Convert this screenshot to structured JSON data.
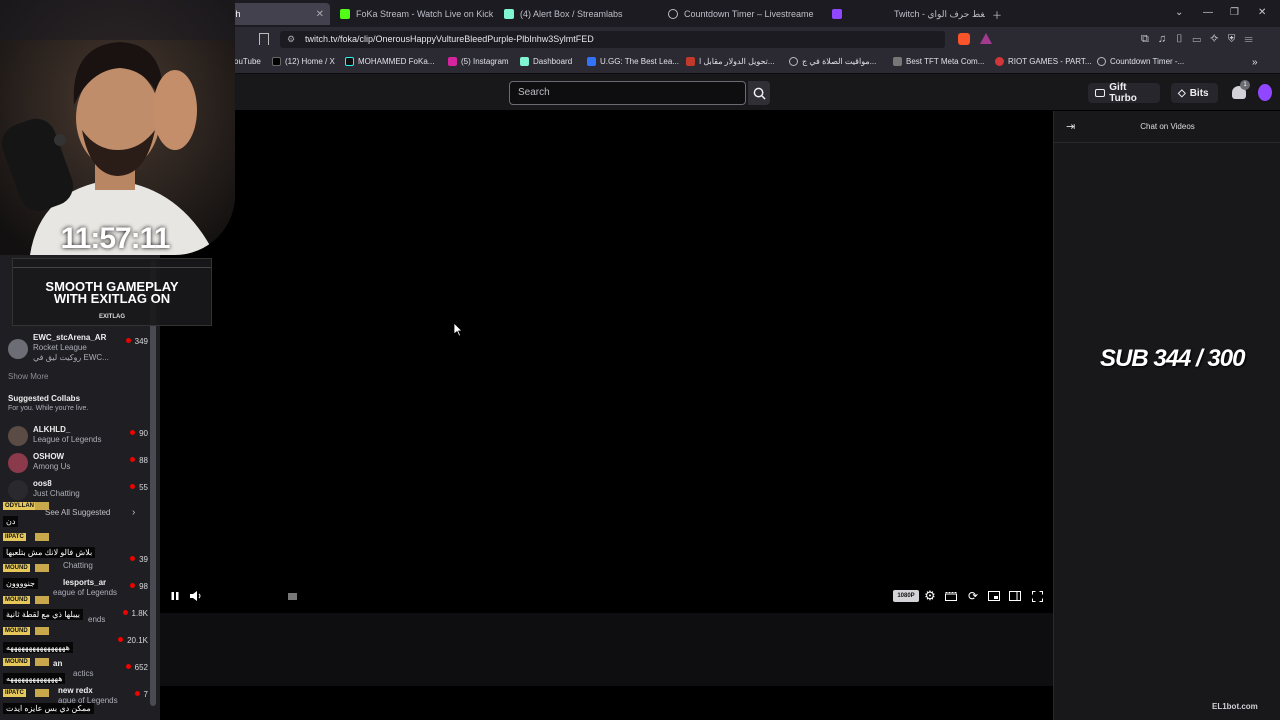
{
  "browser": {
    "tabs": [
      {
        "label": "Twitch",
        "active": true
      },
      {
        "label": "FoKa Stream - Watch Live on Kick"
      },
      {
        "label": "(4) Alert Box / Streamlabs"
      },
      {
        "label": "Countdown Timer – Livestreamer Hu"
      },
      {
        "label": "Twitch - اضغط حرف الواي"
      }
    ],
    "url": "twitch.tv/foka/clip/OnerousHappyVultureBleedPurple-PlbInhw3SylmtFED",
    "bookmarks": [
      {
        "label": "ouTube"
      },
      {
        "label": "(12) Home / X"
      },
      {
        "label": "MOHAMMED FoKa..."
      },
      {
        "label": "(5) Instagram"
      },
      {
        "label": "Dashboard"
      },
      {
        "label": "U.GG: The Best Lea..."
      },
      {
        "label": "تحويل الدولار مقابل ا..."
      },
      {
        "label": "مواقيت الصلاة في ج..."
      },
      {
        "label": "Best TFT Meta Com..."
      },
      {
        "label": "RIOT GAMES - PART..."
      },
      {
        "label": "Countdown Timer -..."
      }
    ]
  },
  "header": {
    "search_placeholder": "Search",
    "gift_turbo": "Gift Turbo",
    "bits": "Bits",
    "notif_count": "1"
  },
  "sidebar": {
    "top_channel": {
      "name": "EWC_stcArena_AR",
      "game": "Rocket League",
      "title": "روكيت ليق في EWC...",
      "viewers": "349"
    },
    "show_more": "Show More",
    "collabs_title": "Suggested Collabs",
    "collabs_sub": "For you. While you're live.",
    "collabs": [
      {
        "name": "ALKHLD_",
        "game": "League of Legends",
        "viewers": "90"
      },
      {
        "name": "OSHOW",
        "game": "Among Us",
        "viewers": "88"
      },
      {
        "name": "oos8",
        "game": "Just Chatting",
        "viewers": "55"
      }
    ],
    "see_all": "See All Suggested",
    "more_rows": [
      {
        "name": "",
        "game": "Chatting",
        "viewers": "39"
      },
      {
        "name": "lesports_ar",
        "game": "eague of Legends",
        "viewers": "98"
      },
      {
        "name": "",
        "game": "ends",
        "viewers": "1.8K"
      },
      {
        "name": "",
        "game": "",
        "viewers": "20.1K"
      },
      {
        "name": "an",
        "game": "actics",
        "viewers": "652"
      },
      {
        "name": "new redx",
        "game": "ague of Legends",
        "viewers": "7"
      }
    ]
  },
  "overlay": {
    "timer": "11:57:11",
    "ad_line1": "SMOOTH GAMEPLAY",
    "ad_line2": "WITH EXITLAG ON",
    "ad_brand": "EXITLAG",
    "chat_messages": [
      {
        "user": "ODYLLAN",
        "text": "دن"
      },
      {
        "user": "IIPATC",
        "text": "بلاش فالو لانك مش بتلعبها"
      },
      {
        "user": "MOUND",
        "text": "جنوووون"
      },
      {
        "user": "MOUND",
        "text": "بيبلها ذي مع لقطة ثانية"
      },
      {
        "user": "MOUND",
        "text": "ههههههههههههههههه"
      },
      {
        "user": "MOUND",
        "text": "ههههههههههههههه"
      },
      {
        "user": "IIPATC",
        "text": "ممكن دي بس عايزه ايدت"
      }
    ],
    "sub_goal": "SUB 344 / 300",
    "watermark": "EL1bot.com"
  },
  "player": {
    "quality": "1080P"
  },
  "chat": {
    "title": "Chat on Videos"
  },
  "colors": {
    "accent": "#9147ff",
    "live": "#eb0400"
  }
}
